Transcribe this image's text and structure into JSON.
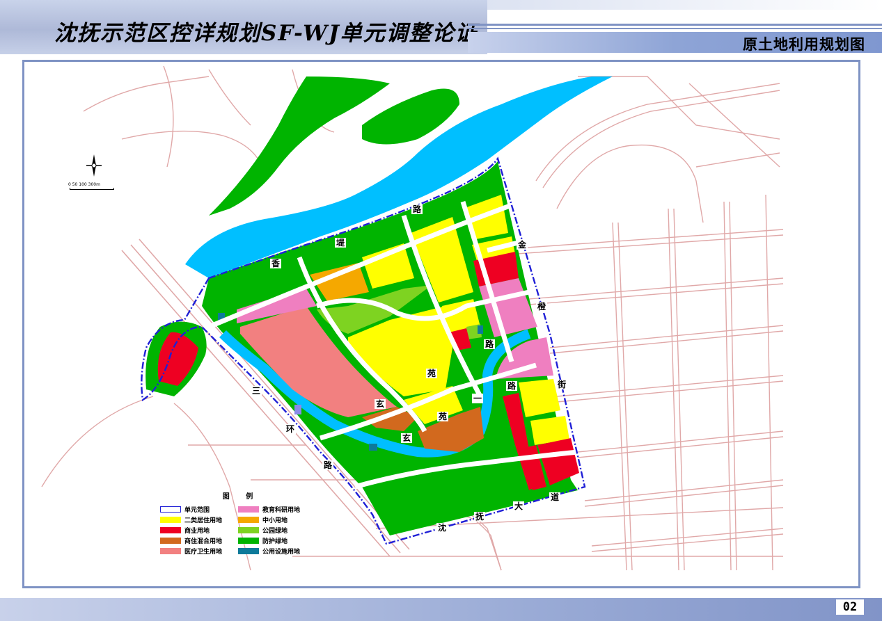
{
  "header": {
    "title": "沈抚示范区控详规划SF-WJ单元调整论证",
    "subtitle": "原土地利用规划图"
  },
  "map": {
    "north_icon": "north-arrow-icon",
    "scale_text": "0  50 100      300m",
    "roads": [
      {
        "id": "xiang-1",
        "label": "香"
      },
      {
        "id": "di",
        "label": "堤"
      },
      {
        "id": "lu-1",
        "label": "路"
      },
      {
        "id": "jin",
        "label": "金"
      },
      {
        "id": "cheng",
        "label": "橙"
      },
      {
        "id": "lu-2",
        "label": "路"
      },
      {
        "id": "jie",
        "label": "街"
      },
      {
        "id": "lu-3",
        "label": "路"
      },
      {
        "id": "yi",
        "label": "一"
      },
      {
        "id": "yuan-1",
        "label": "苑"
      },
      {
        "id": "xuan-1",
        "label": "玄"
      },
      {
        "id": "yuan-2",
        "label": "苑"
      },
      {
        "id": "xuan-2",
        "label": "玄"
      },
      {
        "id": "san",
        "label": "三"
      },
      {
        "id": "huan",
        "label": "环"
      },
      {
        "id": "lu-4",
        "label": "路"
      },
      {
        "id": "shen",
        "label": "沈"
      },
      {
        "id": "fu",
        "label": "抚"
      },
      {
        "id": "da",
        "label": "大"
      },
      {
        "id": "dao",
        "label": "道"
      }
    ]
  },
  "legend": {
    "title": "图  例",
    "items": [
      {
        "label": "单元范围",
        "color": "#1f1fd6",
        "outline": true
      },
      {
        "label": "教育科研用地",
        "color": "#ef7fc0"
      },
      {
        "label": "二类居住用地",
        "color": "#ffff00"
      },
      {
        "label": "中小用地",
        "color": "#f5a800"
      },
      {
        "label": "商业用地",
        "color": "#ee0022"
      },
      {
        "label": "公园绿地",
        "color": "#7ed321"
      },
      {
        "label": "商住混合用地",
        "color": "#d2691e"
      },
      {
        "label": "防护绿地",
        "color": "#00b400"
      },
      {
        "label": "医疗卫生用地",
        "color": "#f28080"
      },
      {
        "label": "公用设施用地",
        "color": "#0e7a9a"
      }
    ]
  },
  "colors": {
    "water": "#00bfff",
    "green": "#00b400",
    "park": "#7ed321",
    "residential": "#ffff00",
    "commercial": "#ee0022",
    "education": "#ef7fc0",
    "school": "#f5a800",
    "mixed": "#d2691e",
    "medical": "#f28080",
    "utility": "#0e7a9a",
    "boundary": "#1f1fd6",
    "road_line": "#e0a8a8",
    "frame": "#7f93c4"
  },
  "footer": {
    "page_number": "02"
  }
}
